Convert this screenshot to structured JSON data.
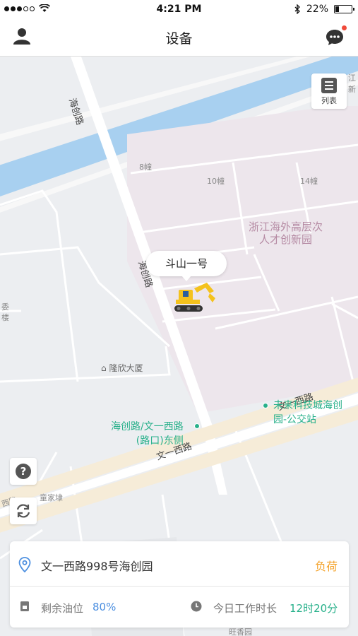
{
  "status_bar": {
    "time": "4:21 PM",
    "battery_percent": "22%",
    "battery_level": 0.22
  },
  "nav": {
    "title": "设备",
    "left_icon": "user-icon",
    "right_icon": "chat-icon",
    "has_notification": true
  },
  "map": {
    "list_button_label": "列表",
    "device_name": "斗山一号",
    "labels": {
      "haichuang_road_top": "海创路",
      "haichuang_road_mid": "海创路",
      "building_8": "8幢",
      "building_10": "10幢",
      "building_14": "14幢",
      "park_name_line1": "浙江海外高层次",
      "park_name_line2": "人才创新园",
      "longxin_building": "隆欣大厦",
      "wenyi_west_road_right": "文一西路",
      "wenyi_west_road_mid": "文一西路",
      "bus_stop_left_line1": "海创路/文一西路",
      "bus_stop_left_line2": "(路口)东侧",
      "bus_stop_right_line1": "未来科技城海创",
      "bus_stop_right_line2": "园-公交站",
      "tongjiadai": "童家埭",
      "wangxiangyuan": "旺香园",
      "left_edge_1": "委",
      "left_edge_2": "楼",
      "left_road_edge": "西路",
      "right_edge": "江",
      "right_edge_2": "新"
    },
    "colors": {
      "water": "#a8d0f0",
      "campus": "#ede6ec",
      "road_main": "#f6ecd8",
      "background": "#eceef1",
      "accent_green": "#27b08a"
    }
  },
  "info_card": {
    "address": "文一西路998号海创园",
    "load_status": "负荷",
    "fuel_label": "剩余油位",
    "fuel_value": "80%",
    "work_label": "今日工作时长",
    "work_value": "12时20分",
    "colors": {
      "load": "#f4a32b",
      "fuel": "#4c8fe0",
      "work": "#27b08a"
    }
  }
}
